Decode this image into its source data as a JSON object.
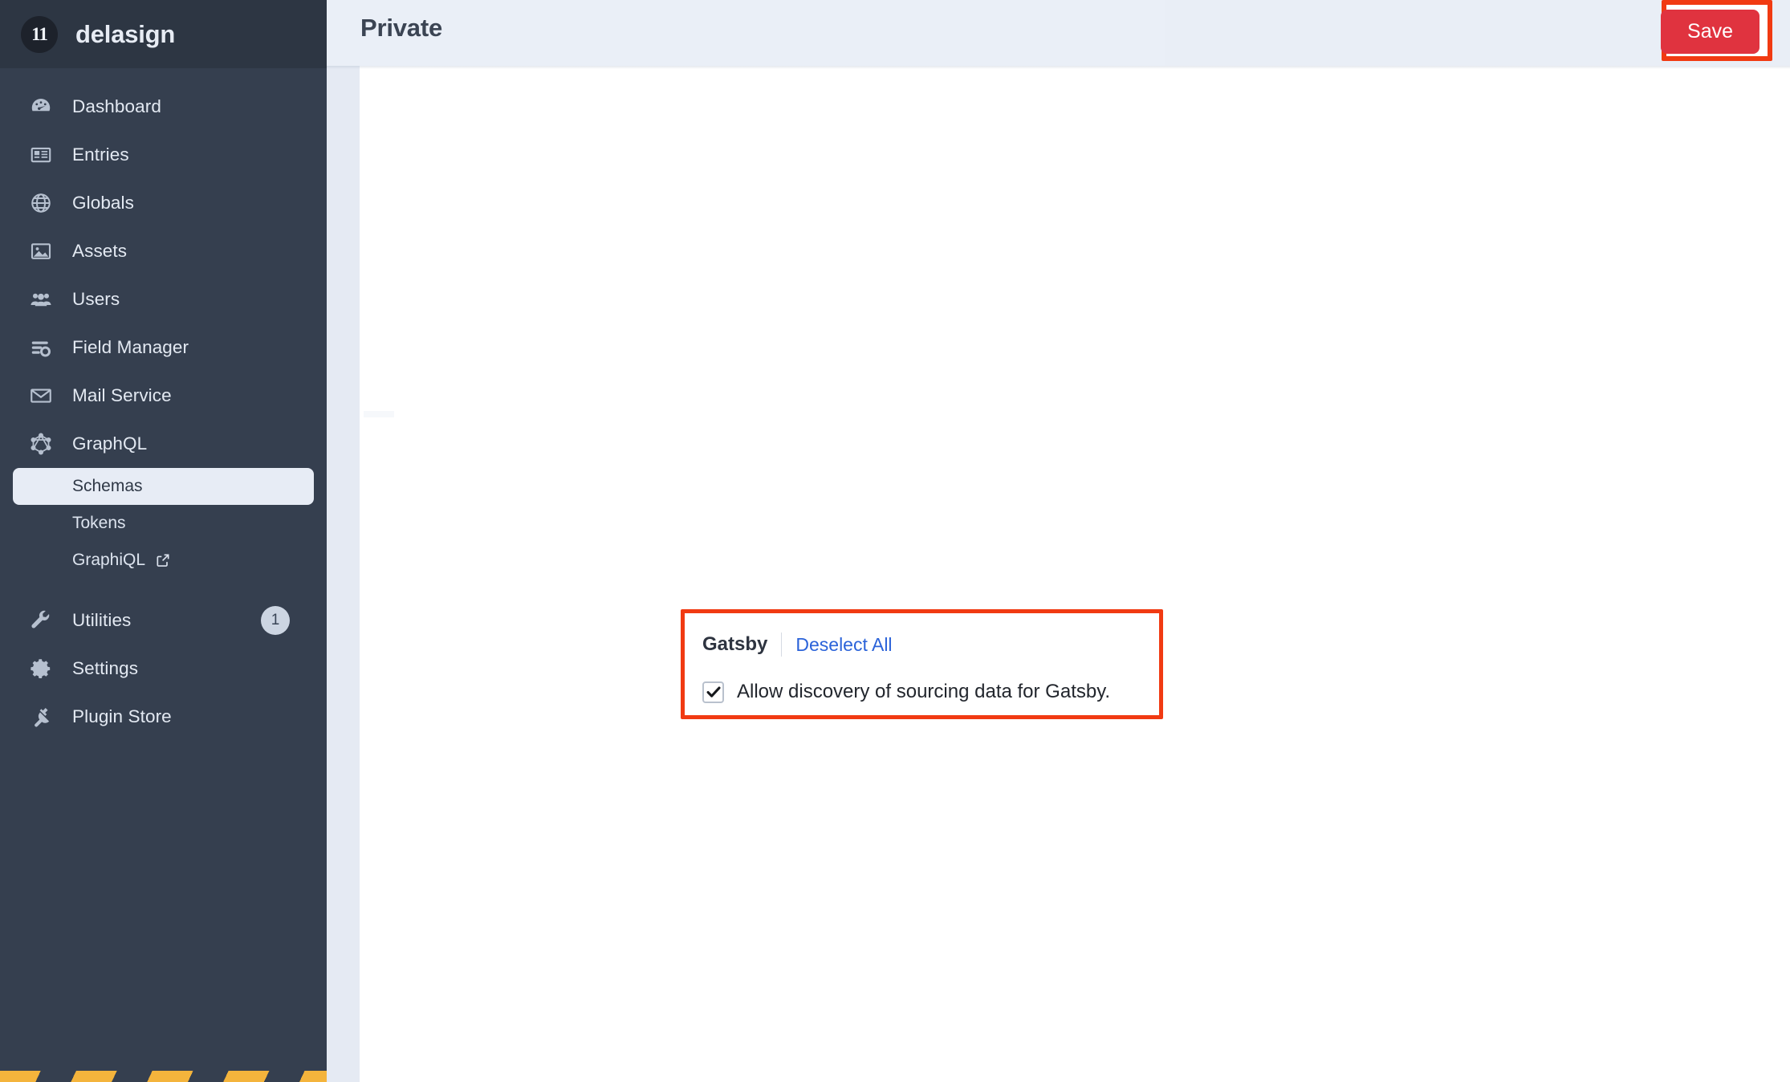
{
  "brand": {
    "logo_glyph": "11",
    "logo_icon": "delasign-logo-icon",
    "name": "delasign"
  },
  "sidebar": {
    "items": [
      {
        "label": "Dashboard",
        "icon": "gauge-icon",
        "badge": null,
        "active": false
      },
      {
        "label": "Entries",
        "icon": "newspaper-icon",
        "badge": null,
        "active": false
      },
      {
        "label": "Globals",
        "icon": "globe-icon",
        "badge": null,
        "active": false
      },
      {
        "label": "Assets",
        "icon": "image-icon",
        "badge": null,
        "active": false
      },
      {
        "label": "Users",
        "icon": "users-icon",
        "badge": null,
        "active": false
      },
      {
        "label": "Field Manager",
        "icon": "sliders-gear-icon",
        "badge": null,
        "active": false
      },
      {
        "label": "Mail Service",
        "icon": "envelope-icon",
        "badge": null,
        "active": false
      },
      {
        "label": "GraphQL",
        "icon": "graphql-icon",
        "badge": null,
        "active": false
      }
    ],
    "sub_items": [
      {
        "label": "Schemas",
        "active": true,
        "external": false
      },
      {
        "label": "Tokens",
        "active": false,
        "external": false
      },
      {
        "label": "GraphiQL",
        "active": false,
        "external": true,
        "external_icon": "external-link-icon"
      }
    ],
    "bottom_items": [
      {
        "label": "Utilities",
        "icon": "wrench-icon",
        "badge": "1"
      },
      {
        "label": "Settings",
        "icon": "gear-icon",
        "badge": null
      },
      {
        "label": "Plugin Store",
        "icon": "plug-icon",
        "badge": null
      }
    ]
  },
  "header": {
    "title": "Private",
    "save_label": "Save"
  },
  "main": {
    "gatsby": {
      "title": "Gatsby",
      "deselect_all_label": "Deselect All",
      "checkbox_label": "Allow discovery of sourcing data for Gatsby.",
      "checkbox_checked": true
    }
  },
  "colors": {
    "sidebar_bg": "#353f4f",
    "sidebar_brand_bg": "#2d3643",
    "topbar_bg": "#e9eef6",
    "save_red": "#e0333f",
    "annotation_red": "#f13a12",
    "link_blue": "#2b63d9",
    "active_sub_bg": "#e7ecf5",
    "hazard_amber": "#f4b43c"
  }
}
